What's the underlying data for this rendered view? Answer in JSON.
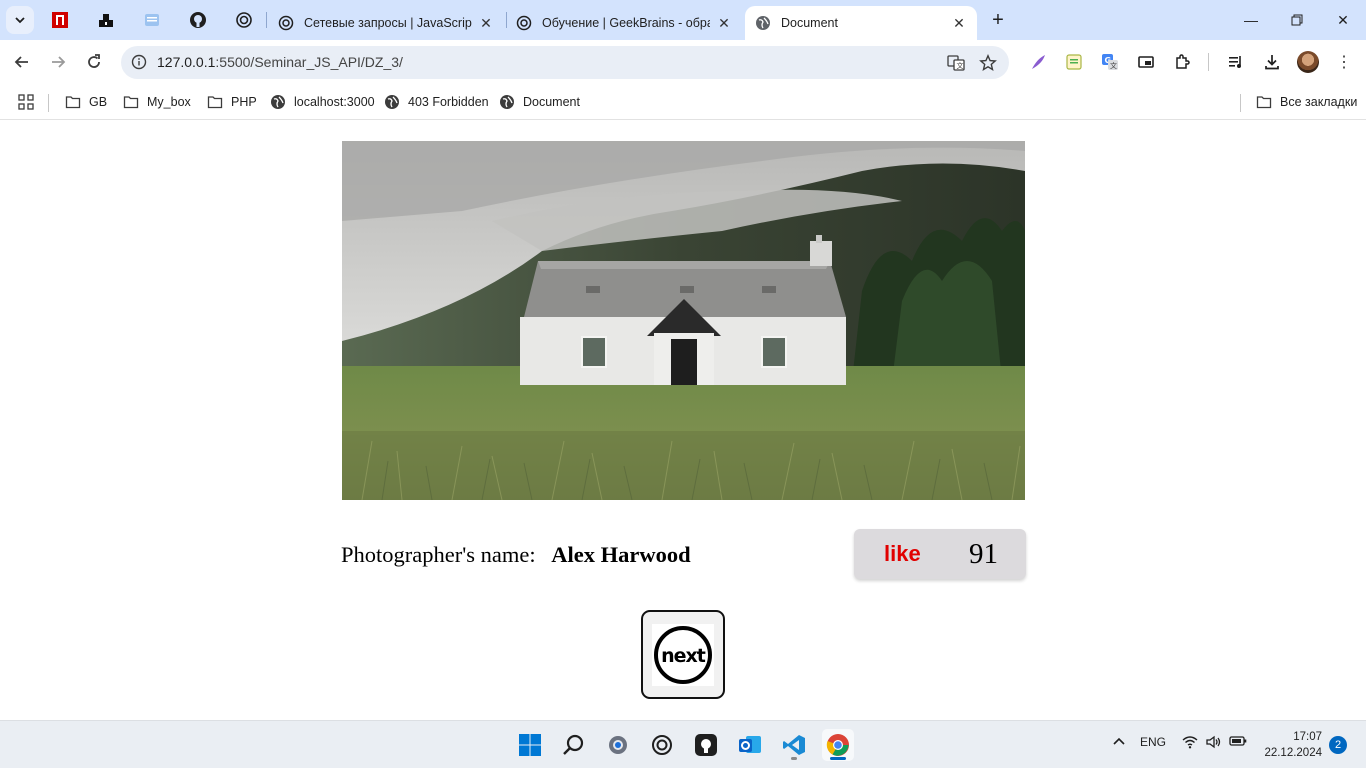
{
  "browser": {
    "tabs": [
      {
        "label": "Сетевые запросы | JavaScript п",
        "icon": "openai-icon",
        "active": false
      },
      {
        "label": "Обучение | GeekBrains - образ",
        "icon": "openai-icon",
        "active": false
      },
      {
        "label": "Document",
        "icon": "globe-icon",
        "active": true
      }
    ],
    "url_host": "127.0.0.1",
    "url_path": ":5500/Seminar_JS_API/DZ_3/",
    "bookmarks": [
      {
        "label": "GB",
        "icon": "folder-icon"
      },
      {
        "label": "My_box",
        "icon": "folder-icon"
      },
      {
        "label": "PHP",
        "icon": "folder-icon"
      },
      {
        "label": "localhost:3000",
        "icon": "globe-icon"
      },
      {
        "label": "403 Forbidden",
        "icon": "globe-icon"
      },
      {
        "label": "Document",
        "icon": "globe-icon"
      }
    ],
    "all_bookmarks": "Все закладки"
  },
  "page": {
    "photographer_label": "Photographer's name:",
    "photographer_name": "Alex Harwood",
    "like_label": "like",
    "like_count": "91",
    "next_label": "next",
    "like_color": "#e10000"
  },
  "taskbar": {
    "language": "ENG",
    "time": "17:07",
    "date": "22.12.2024",
    "notifications": "2"
  }
}
